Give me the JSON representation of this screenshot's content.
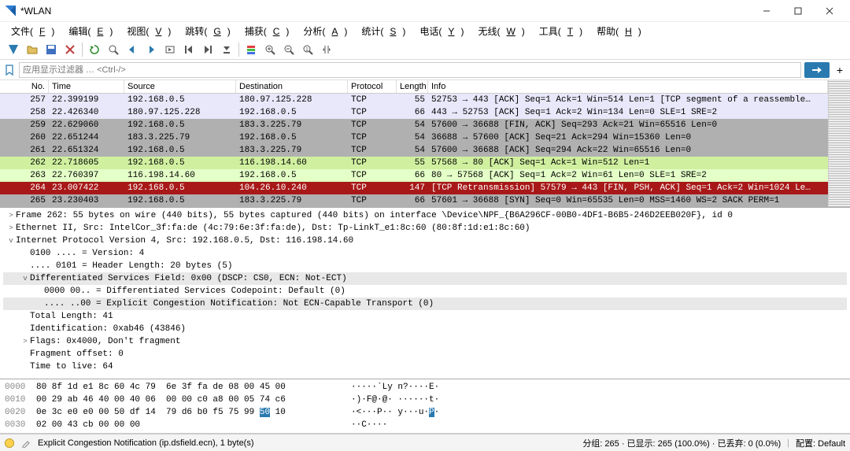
{
  "title": "*WLAN",
  "menu": [
    "文件(F)",
    "编辑(E)",
    "视图(V)",
    "跳转(G)",
    "捕获(C)",
    "分析(A)",
    "统计(S)",
    "电话(Y)",
    "无线(W)",
    "工具(T)",
    "帮助(H)"
  ],
  "filter_placeholder": "应用显示过滤器 … <Ctrl-/>",
  "columns": {
    "no": "No.",
    "time": "Time",
    "src": "Source",
    "dst": "Destination",
    "proto": "Protocol",
    "len": "Length",
    "info": "Info"
  },
  "packets": [
    {
      "no": "257",
      "time": "22.399199",
      "src": "192.168.0.5",
      "dst": "180.97.125.228",
      "proto": "TCP",
      "len": "55",
      "info": "52753 → 443 [ACK] Seq=1 Ack=1 Win=514 Len=1 [TCP segment of a reassemble…",
      "cls": "row-lightpurple"
    },
    {
      "no": "258",
      "time": "22.426340",
      "src": "180.97.125.228",
      "dst": "192.168.0.5",
      "proto": "TCP",
      "len": "66",
      "info": "443 → 52753 [ACK] Seq=1 Ack=2 Win=134 Len=0 SLE=1 SRE=2",
      "cls": "row-lightpurple"
    },
    {
      "no": "259",
      "time": "22.629060",
      "src": "192.168.0.5",
      "dst": "183.3.225.79",
      "proto": "TCP",
      "len": "54",
      "info": "57600 → 36688 [FIN, ACK] Seq=293 Ack=21 Win=65516 Len=0",
      "cls": "row-gray"
    },
    {
      "no": "260",
      "time": "22.651244",
      "src": "183.3.225.79",
      "dst": "192.168.0.5",
      "proto": "TCP",
      "len": "54",
      "info": "36688 → 57600 [ACK] Seq=21 Ack=294 Win=15360 Len=0",
      "cls": "row-gray"
    },
    {
      "no": "261",
      "time": "22.651324",
      "src": "192.168.0.5",
      "dst": "183.3.225.79",
      "proto": "TCP",
      "len": "54",
      "info": "57600 → 36688 [ACK] Seq=294 Ack=22 Win=65516 Len=0",
      "cls": "row-gray"
    },
    {
      "no": "262",
      "time": "22.718605",
      "src": "192.168.0.5",
      "dst": "116.198.14.60",
      "proto": "TCP",
      "len": "55",
      "info": "57568 → 80 [ACK] Seq=1 Ack=1 Win=512 Len=1",
      "cls": "row-selgreen"
    },
    {
      "no": "263",
      "time": "22.760397",
      "src": "116.198.14.60",
      "dst": "192.168.0.5",
      "proto": "TCP",
      "len": "66",
      "info": "80 → 57568 [ACK] Seq=1 Ack=2 Win=61 Len=0 SLE=1 SRE=2",
      "cls": "row-lightgreen"
    },
    {
      "no": "264",
      "time": "23.007422",
      "src": "192.168.0.5",
      "dst": "104.26.10.240",
      "proto": "TCP",
      "len": "147",
      "info": "[TCP Retransmission] 57579 → 443 [FIN, PSH, ACK] Seq=1 Ack=2 Win=1024 Le…",
      "cls": "row-darkred"
    },
    {
      "no": "265",
      "time": "23.230403",
      "src": "192.168.0.5",
      "dst": "183.3.225.79",
      "proto": "TCP",
      "len": "66",
      "info": "57601 → 36688 [SYN] Seq=0 Win=65535 Len=0 MSS=1460 WS=2 SACK PERM=1",
      "cls": "row-gray"
    }
  ],
  "details": [
    {
      "depth": 0,
      "toggle": ">",
      "text": "Frame 262: 55 bytes on wire (440 bits), 55 bytes captured (440 bits) on interface \\Device\\NPF_{B6A296CF-00B0-4DF1-B6B5-246D2EEB020F}, id 0"
    },
    {
      "depth": 0,
      "toggle": ">",
      "text": "Ethernet II, Src: IntelCor_3f:fa:de (4c:79:6e:3f:fa:de), Dst: Tp-LinkT_e1:8c:60 (80:8f:1d:e1:8c:60)"
    },
    {
      "depth": 0,
      "toggle": "v",
      "text": "Internet Protocol Version 4, Src: 192.168.0.5, Dst: 116.198.14.60"
    },
    {
      "depth": 1,
      "toggle": "",
      "text": "0100 .... = Version: 4"
    },
    {
      "depth": 1,
      "toggle": "",
      "text": ".... 0101 = Header Length: 20 bytes (5)"
    },
    {
      "depth": 1,
      "toggle": "v",
      "text": "Differentiated Services Field: 0x00 (DSCP: CS0, ECN: Not-ECT)",
      "sel": true
    },
    {
      "depth": 2,
      "toggle": "",
      "text": "0000 00.. = Differentiated Services Codepoint: Default (0)"
    },
    {
      "depth": 2,
      "toggle": "",
      "text": ".... ..00 = Explicit Congestion Notification: Not ECN-Capable Transport (0)",
      "sel": true
    },
    {
      "depth": 1,
      "toggle": "",
      "text": "Total Length: 41"
    },
    {
      "depth": 1,
      "toggle": "",
      "text": "Identification: 0xab46 (43846)"
    },
    {
      "depth": 1,
      "toggle": ">",
      "text": "Flags: 0x4000, Don't fragment"
    },
    {
      "depth": 1,
      "toggle": "",
      "text": "Fragment offset: 0"
    },
    {
      "depth": 1,
      "toggle": "",
      "text": "Time to live: 64"
    }
  ],
  "hex": [
    {
      "off": "0000",
      "bytes": "80 8f 1d e1 8c 60 4c 79  6e 3f fa de 08 00 45 00",
      "ascii": "·····`Ly n?····E·"
    },
    {
      "off": "0010",
      "bytes": "00 29 ab 46 40 00 40 06  00 00 c0 a8 00 05 74 c6",
      "ascii": "·)·F@·@· ······t·"
    },
    {
      "off": "0020",
      "bytes": "0e 3c e0 e0 00 50 df 14  79 d6 b0 f5 75 99 50 10",
      "ascii": "·<···P·· y···u·P·",
      "hl_byte": 14,
      "hl_ascii": 15
    },
    {
      "off": "0030",
      "bytes": "02 00 43 cb 00 00 00",
      "ascii": "··C····"
    }
  ],
  "status": {
    "field": "Explicit Congestion Notification (ip.dsfield.ecn), 1 byte(s)",
    "packets": "分组: 265 · 已显示: 265 (100.0%) · 已丢弃: 0 (0.0%)",
    "profile": "配置: Default"
  },
  "toolbar_icons": [
    "logo",
    "folder",
    "save",
    "close",
    "reload",
    "find",
    "back",
    "fwd",
    "jump",
    "gotop",
    "gobot",
    "autoscroll",
    "sep",
    "colorize",
    "zoomin",
    "zoomout",
    "zoomreset",
    "resize"
  ]
}
